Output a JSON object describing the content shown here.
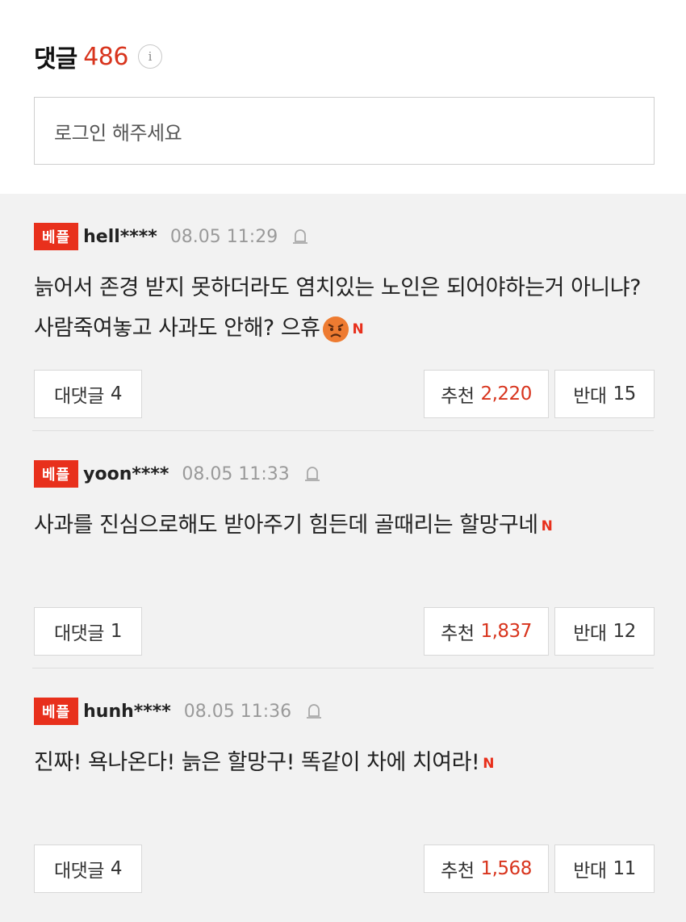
{
  "header": {
    "title": "댓글",
    "count": "486"
  },
  "login": {
    "placeholder": "로그인 해주세요"
  },
  "comments": [
    {
      "badge": "베플",
      "user": "hell****",
      "time": "08.05 11:29",
      "text": "늙어서 존경 받지 못하더라도 염치있는 노인은 되어야하는거 아니냐? 사람죽여놓고 사과도 안해? 으휴",
      "has_emoji": true,
      "reply_label": "대댓글",
      "reply_count": "4",
      "up_label": "추천",
      "up_count": "2,220",
      "down_label": "반대",
      "down_count": "15"
    },
    {
      "badge": "베플",
      "user": "yoon****",
      "time": "08.05 11:33",
      "text": "사과를 진심으로해도 받아주기 힘든데 골때리는 할망구네",
      "has_emoji": false,
      "reply_label": "대댓글",
      "reply_count": "1",
      "up_label": "추천",
      "up_count": "1,837",
      "down_label": "반대",
      "down_count": "12"
    },
    {
      "badge": "베플",
      "user": "hunh****",
      "time": "08.05 11:36",
      "text": "진짜! 욕나온다! 늙은 할망구! 똑같이 차에 치여라!",
      "has_emoji": false,
      "reply_label": "대댓글",
      "reply_count": "4",
      "up_label": "추천",
      "up_count": "1,568",
      "down_label": "반대",
      "down_count": "11"
    }
  ],
  "icons": {
    "info": "info-icon",
    "report": "bell-icon",
    "new": "n-icon",
    "emoji": "angry-face-icon"
  },
  "colors": {
    "accent": "#e8301c",
    "count": "#d8341d"
  },
  "new_mark": "N",
  "info_mark": "i"
}
